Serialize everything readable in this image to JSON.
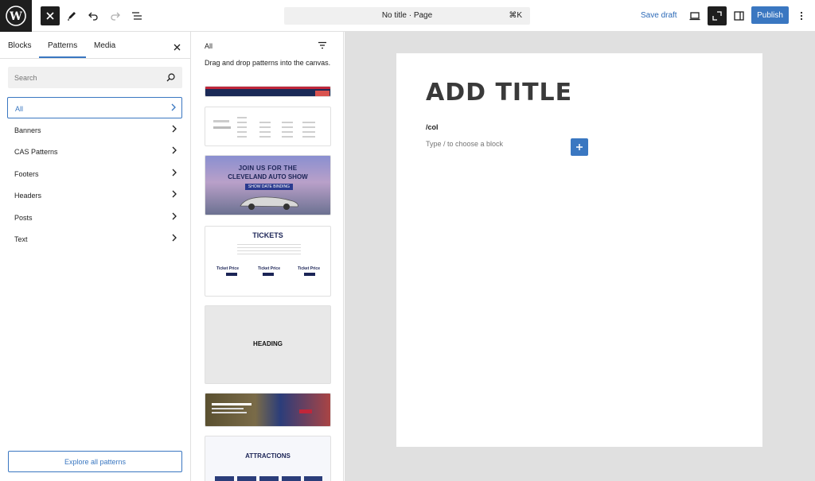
{
  "topbar": {
    "document_title": "No title · Page",
    "shortcut": "⌘K",
    "save_draft": "Save draft",
    "publish": "Publish"
  },
  "inserter": {
    "tabs": [
      "Blocks",
      "Patterns",
      "Media"
    ],
    "active_tab": "Patterns",
    "search_placeholder": "Search",
    "categories": [
      "All",
      "Banners",
      "CAS Patterns",
      "Footers",
      "Headers",
      "Posts",
      "Text"
    ],
    "active_category": "All",
    "explore_button": "Explore all patterns"
  },
  "patterns_panel": {
    "heading": "All",
    "description": "Drag and drop patterns into the canvas.",
    "previews": {
      "banner_line1": "JOIN US FOR THE",
      "banner_line2": "CLEVELAND AUTO SHOW",
      "banner_button": "SHOW DATE BINDING",
      "tickets_title": "TICKETS",
      "ticket_price_label": "Ticket Price",
      "heading_title": "HEADING",
      "attractions_title": "ATTRACTIONS"
    }
  },
  "editor": {
    "title_placeholder": "ADD TITLE",
    "slash_text": "/col",
    "block_hint": "Type / to choose a block"
  },
  "colors": {
    "accent": "#3a77c1",
    "toolbar_dark": "#1e1e1e",
    "canvas_bg": "#e0e0e0"
  }
}
